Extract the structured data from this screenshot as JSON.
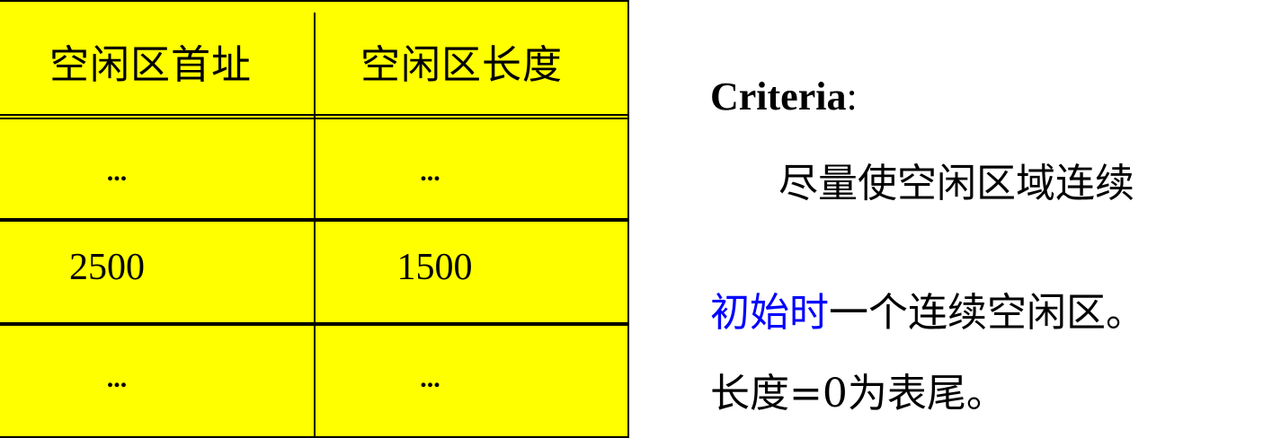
{
  "table": {
    "headers": [
      "空闲区首址",
      "空闲区长度"
    ],
    "rows": [
      [
        "...",
        "..."
      ],
      [
        "2500",
        "1500"
      ],
      [
        "...",
        "..."
      ]
    ],
    "background_color": "#ffff00"
  },
  "criteria": {
    "label": "Criteria",
    "colon": ":",
    "text": "尽量使空闲区域连续"
  },
  "notes": {
    "line1_highlight": "初始时",
    "line1_rest": "一个连续空闲区。",
    "line2": "长度=0为表尾。",
    "highlight_color": "#0000ff"
  }
}
